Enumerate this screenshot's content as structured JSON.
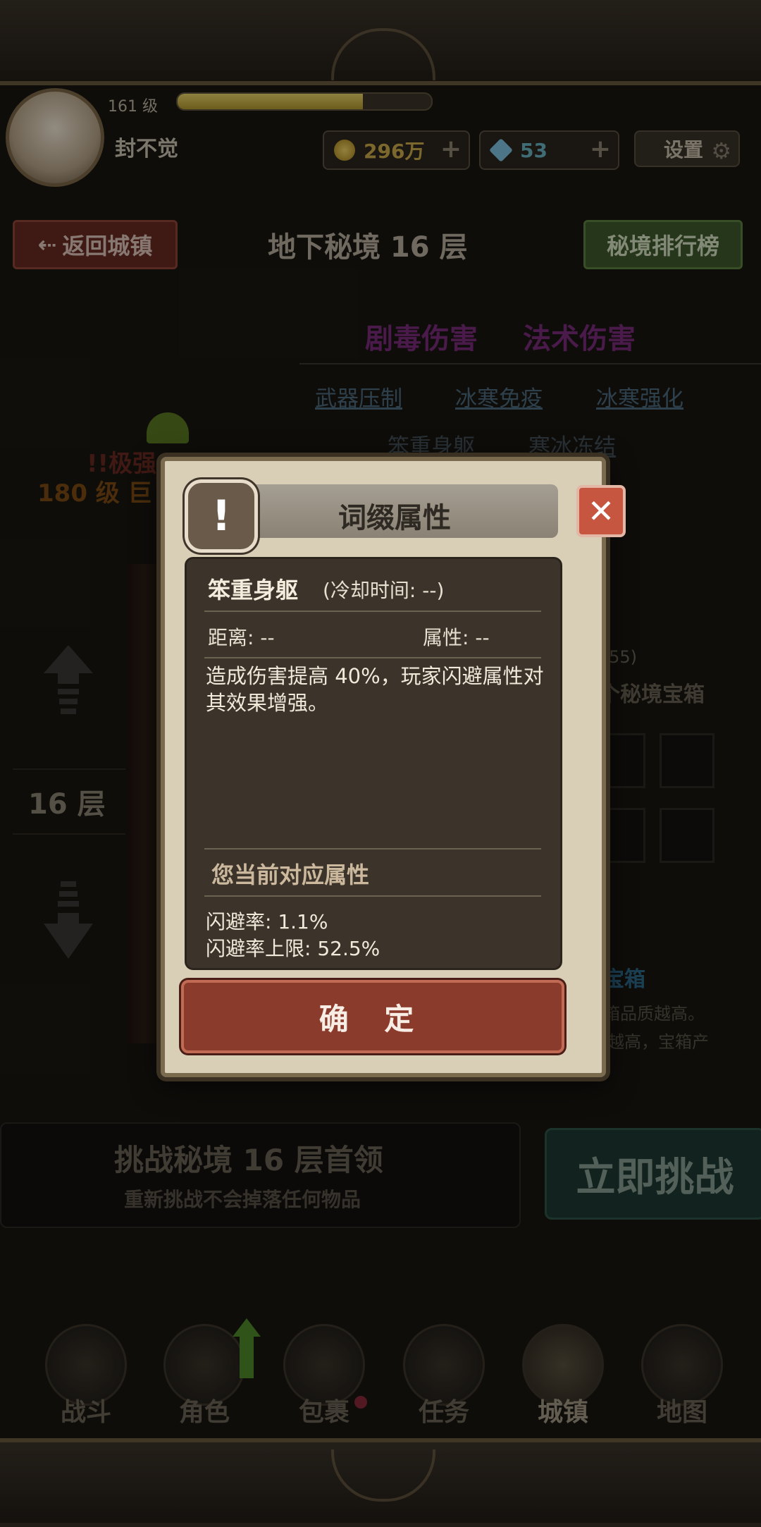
{
  "header": {
    "level": "161 级",
    "xp_progress": 0.73,
    "player_name": "封不觉",
    "gold": "296万",
    "gems": "53",
    "settings_label": "设置"
  },
  "nav": {
    "back_label": "返回城镇",
    "title": "地下秘境 16 层",
    "ranking_label": "秘境排行榜"
  },
  "affixes": {
    "main": [
      "剧毒伤害",
      "法术伤害"
    ],
    "sub": [
      "武器压制",
      "冰寒免疫",
      "冰寒强化"
    ],
    "faded": [
      "笨重身躯",
      "寒冰冻结"
    ]
  },
  "left_panel": {
    "warning_1": "!!极强",
    "warning_2": "180 级 巨",
    "floor_label": "16 层"
  },
  "right_panel": {
    "timer": ":55)",
    "chest_title": "个秘境宝箱",
    "chest_link": "宝箱",
    "chest_desc_1": "箱品质越高。",
    "chest_desc_2": "越高，宝箱产"
  },
  "challenge": {
    "title": "挑战秘境 16 层首领",
    "note": "重新挑战不会掉落任何物品",
    "button_label": "立即挑战"
  },
  "bottom_nav": [
    {
      "label": "战斗"
    },
    {
      "label": "角色"
    },
    {
      "label": "包裹"
    },
    {
      "label": "任务"
    },
    {
      "label": "城镇"
    },
    {
      "label": "地图"
    }
  ],
  "dialog": {
    "title": "词缀属性",
    "alert_symbol": "!",
    "close_symbol": "✕",
    "skill_name": "笨重身躯",
    "cooldown": "(冷却时间: --)",
    "distance": "距离: --",
    "attribute": "属性: --",
    "description": "造成伤害提高 40%，玩家闪避属性对其效果增强。",
    "current_attr_title": "您当前对应属性",
    "dodge_rate": "闪避率: 1.1%",
    "dodge_cap": "闪避率上限: 52.5%",
    "confirm_label": "确 定"
  }
}
